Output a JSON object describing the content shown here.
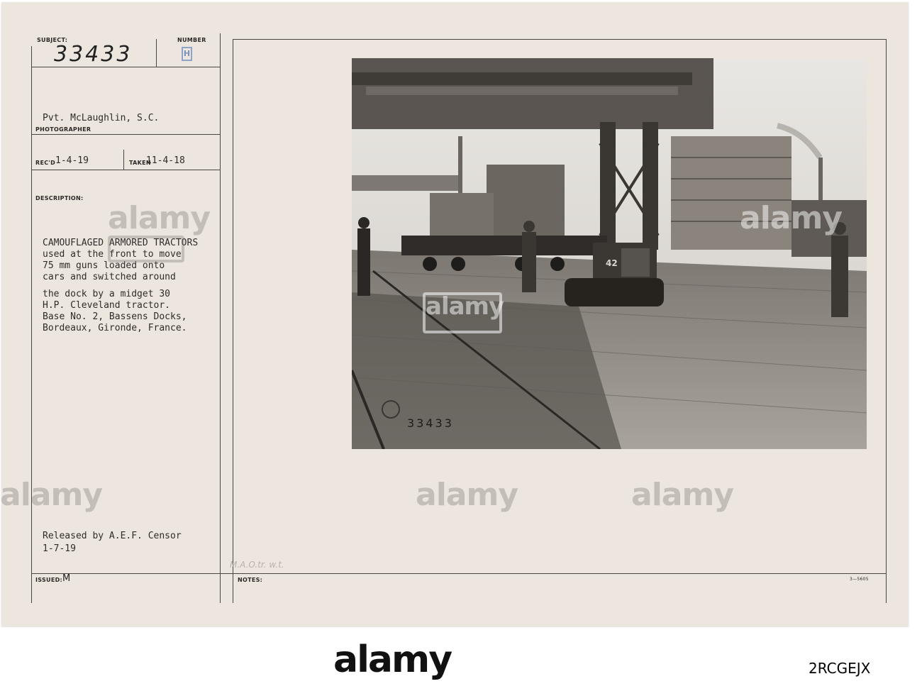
{
  "form": {
    "subject_label": "SUBJECT:",
    "subject_number": "33433",
    "number_label": "NUMBER",
    "number_mark": "H",
    "photographer_name": "Pvt. McLaughlin, S.C.",
    "photographer_label": "PHOTOGRAPHER",
    "recd_label": "REC'D",
    "recd_date": "1-4-19",
    "taken_label": "TAKEN",
    "taken_date": "11-4-18",
    "description_label": "DESCRIPTION:",
    "description_lines": [
      "CAMOUFLAGED ARMORED TRACTORS",
      "used at the front to move",
      "75 mm guns loaded onto",
      "cars and switched around",
      "",
      "the dock by a midget 30",
      "H.P. Cleveland tractor.",
      "Base No. 2, Bassens Docks,",
      "Bordeaux, Gironde, France."
    ],
    "released_line1": "Released by A.E.F. Censor",
    "released_line2": "1-7-19",
    "issued_label": "ISSUED:",
    "issued_mark": "M",
    "notes_label": "NOTES:",
    "notes_handwritten": "M.A.O.tr. w.t.",
    "form_code": "3—5605"
  },
  "photo": {
    "negative_number": "33433",
    "tractor_number": "42"
  },
  "watermark": {
    "brand": "alamy"
  },
  "footer": {
    "brand": "alamy",
    "url": "",
    "image_id": "2RCGEJX"
  }
}
